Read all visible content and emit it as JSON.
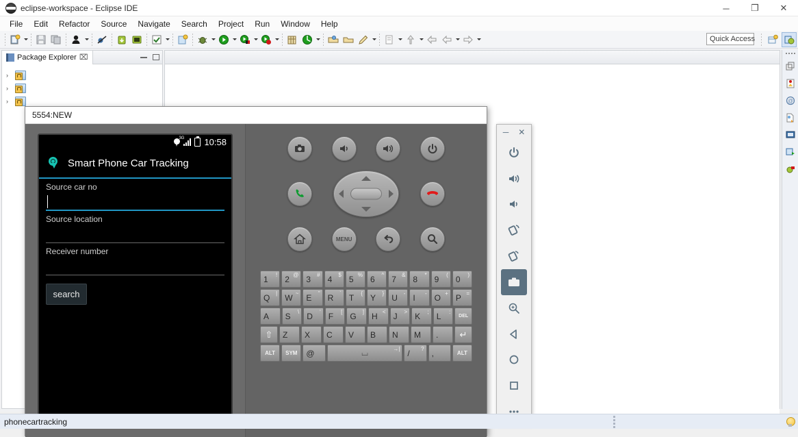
{
  "window": {
    "title": "eclipse-workspace - Eclipse IDE",
    "minimize": "─",
    "restore": "❐",
    "close": "✕"
  },
  "menu": [
    {
      "label": "File"
    },
    {
      "label": "Edit"
    },
    {
      "label": "Refactor"
    },
    {
      "label": "Source"
    },
    {
      "label": "Navigate"
    },
    {
      "label": "Search"
    },
    {
      "label": "Project"
    },
    {
      "label": "Run"
    },
    {
      "label": "Window"
    },
    {
      "label": "Help"
    }
  ],
  "toolbar": {
    "quick_access": "Quick Access",
    "icons": [
      "new-wizard-icon",
      "save-icon",
      "save-all-icon",
      "user-icon",
      "skip-breakpoints-icon",
      "android-sdk-manager-icon",
      "android-avd-manager-icon",
      "check-icon",
      "new-android-project-icon",
      "debug-icon",
      "run-icon",
      "run-external-tools-icon",
      "run-last-tool-icon",
      "new-package-icon",
      "coverage-icon",
      "open-type-icon",
      "open-task-icon",
      "edit-icon",
      "annotation-icon",
      "next-annotation-icon",
      "back-icon",
      "previous-icon",
      "forward-icon"
    ]
  },
  "package_explorer": {
    "tab_label": "Package Explorer",
    "close_glyph": "⌧",
    "projects": [
      {
        "name": ""
      },
      {
        "name": ""
      },
      {
        "name": ""
      }
    ],
    "expand_arrow": "›"
  },
  "emulator": {
    "title": "5554:NEW",
    "phone": {
      "status_bar": {
        "time": "10:58",
        "network": "3G",
        "icons": [
          "location-pin-icon",
          "signal-icon",
          "battery-icon"
        ]
      },
      "app": {
        "title": "Smart Phone Car Tracking",
        "logo_icon": "location-tracking-icon",
        "fields": [
          {
            "label": "Source car no",
            "value": "",
            "focused": true
          },
          {
            "label": "Source location",
            "value": "",
            "focused": false
          },
          {
            "label": "Receiver number",
            "value": "",
            "focused": false
          }
        ],
        "button": "search"
      }
    },
    "hardware_buttons": [
      {
        "name": "camera-button",
        "icon": "camera-icon"
      },
      {
        "name": "volume-down-button",
        "icon": "volume-down-icon"
      },
      {
        "name": "volume-up-button",
        "icon": "volume-up-icon"
      },
      {
        "name": "power-button",
        "icon": "power-icon"
      },
      {
        "name": "call-button",
        "icon": "call-icon"
      },
      {
        "name": "dpad",
        "icon": "dpad-icon"
      },
      {
        "name": "end-call-button",
        "icon": "end-call-icon"
      },
      {
        "name": "home-button",
        "icon": "home-icon"
      },
      {
        "name": "menu-button",
        "icon": "menu-icon",
        "label": "MENU"
      },
      {
        "name": "back-button",
        "icon": "back-icon"
      },
      {
        "name": "search-button",
        "icon": "search-icon"
      }
    ],
    "keyboard": {
      "row1": [
        {
          "main": "1",
          "sub": "!"
        },
        {
          "main": "2",
          "sub": "@"
        },
        {
          "main": "3",
          "sub": "#"
        },
        {
          "main": "4",
          "sub": "$"
        },
        {
          "main": "5",
          "sub": "%"
        },
        {
          "main": "6",
          "sub": "^"
        },
        {
          "main": "7",
          "sub": "&"
        },
        {
          "main": "8",
          "sub": "*"
        },
        {
          "main": "9",
          "sub": "("
        },
        {
          "main": "0",
          "sub": ")"
        }
      ],
      "row2": [
        {
          "main": "Q",
          "sub": "|"
        },
        {
          "main": "W",
          "sub": "~"
        },
        {
          "main": "E",
          "sub": "”"
        },
        {
          "main": "R",
          "sub": "`"
        },
        {
          "main": "T",
          "sub": "{"
        },
        {
          "main": "Y",
          "sub": "}"
        },
        {
          "main": "U",
          "sub": "-"
        },
        {
          "main": "I",
          "sub": "-"
        },
        {
          "main": "O",
          "sub": "+"
        },
        {
          "main": "P",
          "sub": "="
        }
      ],
      "row3": [
        {
          "main": "A",
          "sub": ""
        },
        {
          "main": "S",
          "sub": "\\"
        },
        {
          "main": "D",
          "sub": "‘"
        },
        {
          "main": "F",
          "sub": "["
        },
        {
          "main": "G",
          "sub": "]"
        },
        {
          "main": "H",
          "sub": "<"
        },
        {
          "main": "J",
          "sub": ">"
        },
        {
          "main": "K",
          "sub": ";"
        },
        {
          "main": "L",
          "sub": ":"
        },
        {
          "main": "DEL",
          "sub": ""
        }
      ],
      "row4": [
        {
          "main": "⇧",
          "sub": ""
        },
        {
          "main": "Z",
          "sub": ""
        },
        {
          "main": "X",
          "sub": ""
        },
        {
          "main": "C",
          "sub": ""
        },
        {
          "main": "V",
          "sub": ""
        },
        {
          "main": "B",
          "sub": ""
        },
        {
          "main": "N",
          "sub": ""
        },
        {
          "main": "M",
          "sub": ""
        },
        {
          "main": ".",
          "sub": ""
        },
        {
          "main": "↵",
          "sub": ""
        }
      ],
      "row5": [
        {
          "main": "ALT",
          "sub": ""
        },
        {
          "main": "SYM",
          "sub": ""
        },
        {
          "main": "@",
          "sub": ""
        },
        {
          "main": "⌴",
          "sub": "→|"
        },
        {
          "main": "/",
          "sub": "?"
        },
        {
          "main": ",",
          "sub": ""
        },
        {
          "main": "ALT",
          "sub": ""
        }
      ]
    },
    "side_toolbar": {
      "minimize": "─",
      "close": "✕",
      "buttons": [
        "power-icon",
        "volume-up-icon",
        "volume-down-icon",
        "rotate-left-icon",
        "rotate-right-icon",
        "screenshot-icon",
        "zoom-icon",
        "back-triangle-icon",
        "home-circle-icon",
        "overview-square-icon",
        "more-icon"
      ]
    }
  },
  "fastview": {
    "icons": [
      "restore-icon",
      "debug-perspective-icon",
      "at-icon",
      "javadoc-icon",
      "console-icon",
      "servers-icon",
      "ddms-icon"
    ]
  },
  "statusbar": {
    "text": "phonecartracking",
    "tip_icon": "lightbulb-icon"
  }
}
